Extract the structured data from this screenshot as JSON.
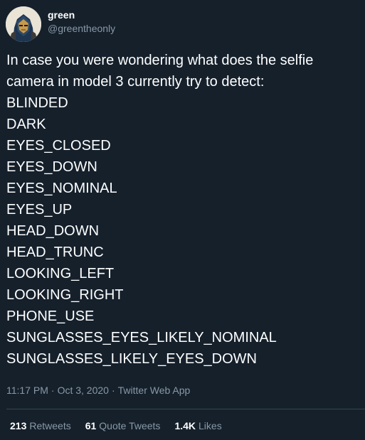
{
  "author": {
    "display_name": "green",
    "handle": "@greentheonly",
    "avatar": "avatar-portrait-icon"
  },
  "tweet": {
    "intro": "In case you were wondering what does the selfie camera in model 3 currently try to detect:",
    "labels": [
      "BLINDED",
      "DARK",
      "EYES_CLOSED",
      "EYES_DOWN",
      "EYES_NOMINAL",
      "EYES_UP",
      "HEAD_DOWN",
      "HEAD_TRUNC",
      "LOOKING_LEFT",
      "LOOKING_RIGHT",
      "PHONE_USE",
      "SUNGLASSES_EYES_LIKELY_NOMINAL",
      "SUNGLASSES_LIKELY_EYES_DOWN"
    ]
  },
  "meta": {
    "time": "11:17 PM",
    "separator": "·",
    "date": "Oct 3, 2020",
    "source": "Twitter Web App"
  },
  "stats": {
    "retweets_count": "213",
    "retweets_label": "Retweets",
    "quote_count": "61",
    "quote_label": "Quote Tweets",
    "likes_count": "1.4K",
    "likes_label": "Likes"
  },
  "colors": {
    "background": "#15202b",
    "text_primary": "#ffffff",
    "text_secondary": "#8899a6",
    "divider": "#38444d"
  }
}
